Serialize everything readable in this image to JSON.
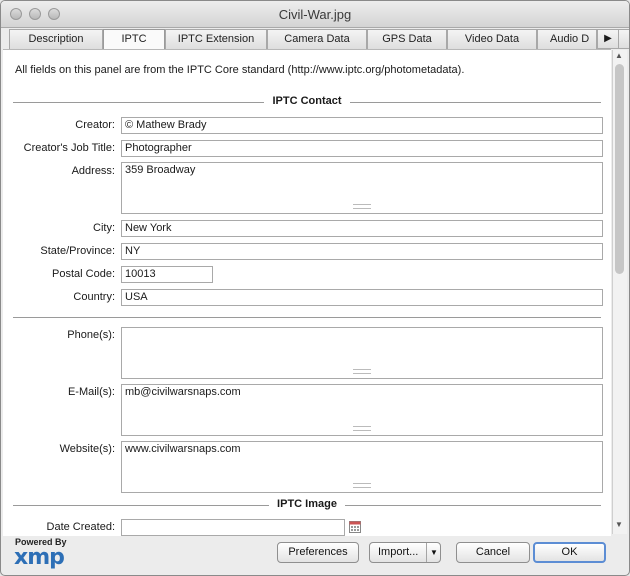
{
  "window": {
    "title": "Civil-War.jpg"
  },
  "tabs": [
    {
      "label": "Description"
    },
    {
      "label": "IPTC"
    },
    {
      "label": "IPTC Extension"
    },
    {
      "label": "Camera Data"
    },
    {
      "label": "GPS Data"
    },
    {
      "label": "Video Data"
    },
    {
      "label": "Audio D"
    }
  ],
  "active_tab": "IPTC",
  "panel": {
    "intro": "All fields on this panel are from the IPTC Core standard (http://www.iptc.org/photometadata).",
    "contact_section": "IPTC Contact",
    "image_section": "IPTC Image",
    "fields": {
      "creator": {
        "label": "Creator:",
        "value": "© Mathew Brady"
      },
      "job_title": {
        "label": "Creator's Job Title:",
        "value": "Photographer"
      },
      "address": {
        "label": "Address:",
        "value": "359 Broadway"
      },
      "city": {
        "label": "City:",
        "value": "New York"
      },
      "state": {
        "label": "State/Province:",
        "value": "NY"
      },
      "postal": {
        "label": "Postal Code:",
        "value": "10013"
      },
      "country": {
        "label": "Country:",
        "value": "USA"
      },
      "phones": {
        "label": "Phone(s):",
        "value": ""
      },
      "emails": {
        "label": "E-Mail(s):",
        "value": "mb@civilwarsnaps.com"
      },
      "websites": {
        "label": "Website(s):",
        "value": "www.civilwarsnaps.com"
      },
      "date_created": {
        "label": "Date Created:",
        "value": ""
      }
    }
  },
  "footer": {
    "powered_by": "Powered By",
    "logo_text": "xmp",
    "preferences": "Preferences",
    "import": "Import...",
    "cancel": "Cancel",
    "ok": "OK"
  },
  "colors": {
    "accent": "#5c8dd4",
    "logo": "#2d6fb6"
  }
}
